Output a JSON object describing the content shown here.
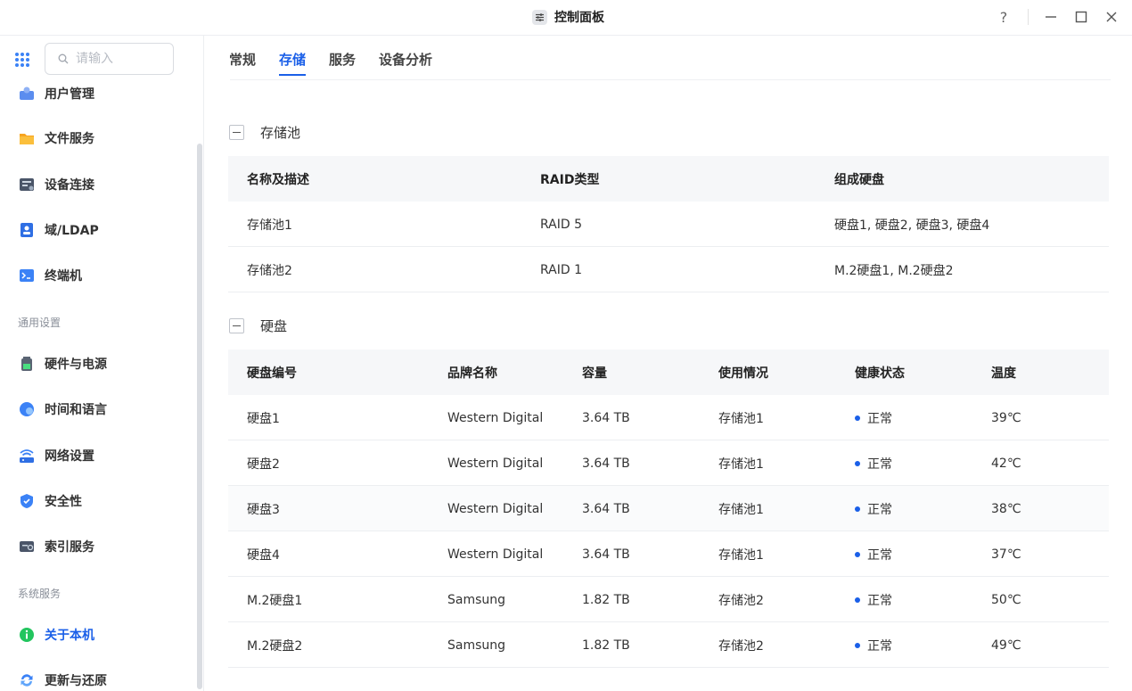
{
  "window": {
    "title": "控制面板",
    "help_label": "?"
  },
  "sidebar": {
    "search_placeholder": "请输入",
    "items_top": [
      {
        "label": "用户管理",
        "icon": "user-icon"
      },
      {
        "label": "文件服务",
        "icon": "folder-icon"
      },
      {
        "label": "设备连接",
        "icon": "device-icon"
      },
      {
        "label": "域/LDAP",
        "icon": "ldap-icon"
      },
      {
        "label": "终端机",
        "icon": "terminal-icon"
      }
    ],
    "group_general": "通用设置",
    "items_general": [
      {
        "label": "硬件与电源",
        "icon": "battery-icon"
      },
      {
        "label": "时间和语言",
        "icon": "globe-icon"
      },
      {
        "label": "网络设置",
        "icon": "wifi-icon"
      },
      {
        "label": "安全性",
        "icon": "shield-icon"
      },
      {
        "label": "索引服务",
        "icon": "index-icon"
      }
    ],
    "group_system": "系统服务",
    "items_system": [
      {
        "label": "关于本机",
        "icon": "info-icon",
        "active": true
      },
      {
        "label": "更新与还原",
        "icon": "refresh-icon"
      }
    ]
  },
  "tabs": [
    {
      "label": "常规"
    },
    {
      "label": "存储",
      "active": true
    },
    {
      "label": "服务"
    },
    {
      "label": "设备分析"
    }
  ],
  "pool_section": {
    "title": "存储池",
    "headers": [
      "名称及描述",
      "RAID类型",
      "组成硬盘"
    ],
    "rows": [
      [
        "存储池1",
        "RAID 5",
        "硬盘1, 硬盘2, 硬盘3, 硬盘4"
      ],
      [
        "存储池2",
        "RAID 1",
        "M.2硬盘1, M.2硬盘2"
      ]
    ]
  },
  "disk_section": {
    "title": "硬盘",
    "headers": [
      "硬盘编号",
      "品牌名称",
      "容量",
      "使用情况",
      "健康状态",
      "温度"
    ],
    "rows": [
      [
        "硬盘1",
        "Western Digital",
        "3.64 TB",
        "存储池1",
        "正常",
        "39℃"
      ],
      [
        "硬盘2",
        "Western Digital",
        "3.64 TB",
        "存储池1",
        "正常",
        "42℃"
      ],
      [
        "硬盘3",
        "Western Digital",
        "3.64 TB",
        "存储池1",
        "正常",
        "38℃"
      ],
      [
        "硬盘4",
        "Western Digital",
        "3.64 TB",
        "存储池1",
        "正常",
        "37℃"
      ],
      [
        "M.2硬盘1",
        "Samsung",
        "1.82 TB",
        "存储池2",
        "正常",
        "50℃"
      ],
      [
        "M.2硬盘2",
        "Samsung",
        "1.82 TB",
        "存储池2",
        "正常",
        "49℃"
      ]
    ]
  },
  "colors": {
    "accent": "#1a5fe8",
    "status_ok": "#1a5fe8"
  }
}
